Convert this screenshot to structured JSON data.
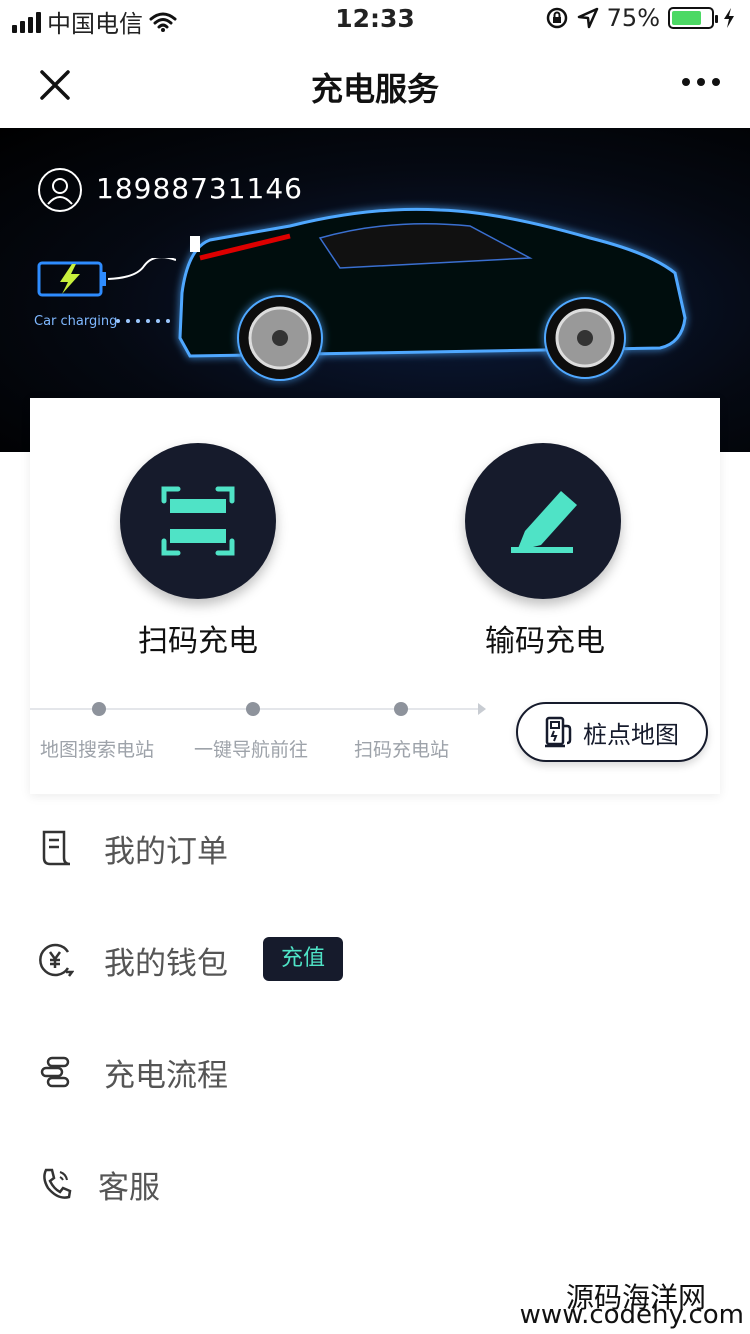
{
  "status_bar": {
    "carrier": "中国电信",
    "time": "12:33",
    "battery_percent": "75%",
    "battery_level": 0.75,
    "icons": [
      "signal-icon",
      "wifi-icon",
      "rotation-lock-icon",
      "location-arrow-icon",
      "battery-icon",
      "charging-bolt-icon"
    ]
  },
  "nav": {
    "title": "充电服务",
    "close_icon": "close-icon",
    "more_icon": "more-icon"
  },
  "banner": {
    "phone": "18988731146",
    "charging_text": "Car charging",
    "colors": {
      "glow": "#4fa8ff",
      "background": "#050912",
      "battery_bolt": "#c8f03c"
    }
  },
  "actions": {
    "scan": {
      "label": "扫码充电",
      "icon": "scan-icon"
    },
    "input": {
      "label": "输码充电",
      "icon": "pencil-icon"
    }
  },
  "steps": [
    {
      "label": "地图搜索电站"
    },
    {
      "label": "一键导航前往"
    },
    {
      "label": "扫码充电站"
    }
  ],
  "map_button": {
    "label": "桩点地图",
    "icon": "charging-pile-icon"
  },
  "menu": [
    {
      "label": "我的订单",
      "icon": "receipt-icon"
    },
    {
      "label": "我的钱包",
      "icon": "wallet-yuan-icon",
      "badge": "充值"
    },
    {
      "label": "充电流程",
      "icon": "flow-icon"
    },
    {
      "label": "客服",
      "icon": "phone-call-icon"
    }
  ],
  "watermark": {
    "line1": "源码海洋网",
    "line2": "www.codehy.com"
  },
  "colors": {
    "dark": "#161b2c",
    "accent": "#4fe3c6",
    "text_gray": "#555555"
  }
}
